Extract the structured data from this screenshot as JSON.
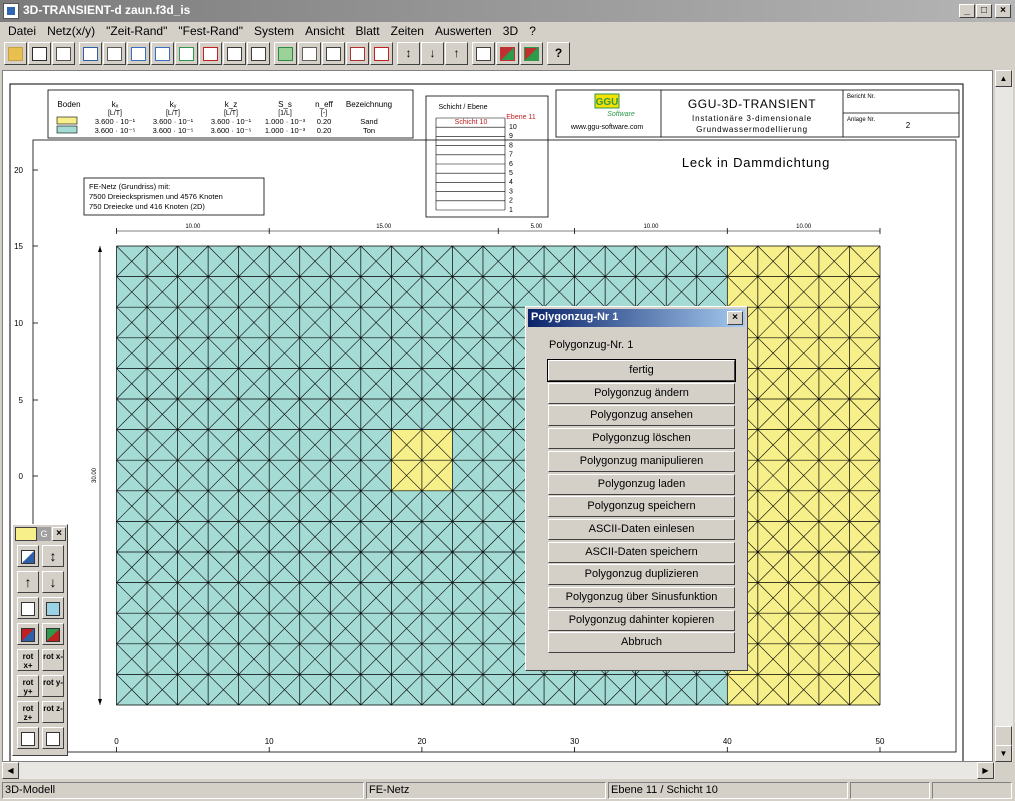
{
  "window": {
    "title": "3D-TRANSIENT-d zaun.f3d_is",
    "minimize": "_",
    "maximize": "□",
    "close": "×"
  },
  "menu": [
    "Datei",
    "Netz(x/y)",
    "\"Zeit-Rand\"",
    "\"Fest-Rand\"",
    "System",
    "Ansicht",
    "Blatt",
    "Zeiten",
    "Auswerten",
    "3D",
    "?"
  ],
  "toolbar": {
    "icons": [
      "open-folder-icon",
      "save-icon",
      "print-icon",
      "filter-icon",
      "page-view-icon",
      "zoom-icon",
      "zoom-in-icon",
      "zoom-node-icon",
      "zoom-element-icon",
      "polygon-select-icon",
      "polygon-icon",
      "grid-icon",
      "copy-icon",
      "clock-icon",
      "frame-icon",
      "house-icon",
      "arrow-updown-icon",
      "arrow-down-icon",
      "arrow-up-icon",
      "mesh-line-icon",
      "color-layer-icon",
      "color-fill-icon",
      "help-icon"
    ],
    "help_label": "?"
  },
  "drawing": {
    "legend": {
      "headers": [
        "Boden",
        "kₓ",
        "kᵧ",
        "k_z",
        "S_s",
        "n_eff",
        "Bezeichnung"
      ],
      "units": [
        "",
        "[L/T]",
        "[L/T]",
        "[L/T]",
        "[1/L]",
        "[-]",
        ""
      ],
      "rows": [
        {
          "color": "#f6ef8a",
          "kx": "3.600 · 10⁻¹",
          "ky": "3.600 · 10⁻¹",
          "kz": "3.600 · 10⁻¹",
          "ss": "1.000 · 10⁻³",
          "neff": "0.20",
          "name": "Sand"
        },
        {
          "color": "#a5dbd5",
          "kx": "3.600 · 10⁻⁵",
          "ky": "3.600 · 10⁻⁵",
          "kz": "3.600 · 10⁻⁵",
          "ss": "1.000 · 10⁻³",
          "neff": "0.20",
          "name": "Ton"
        }
      ]
    },
    "layers": {
      "title": "Schicht / Ebene",
      "current_layer": "Schicht 10",
      "current_plane": "Ebene 11",
      "planes": [
        "10",
        "9",
        "8",
        "7",
        "6",
        "5",
        "4",
        "3",
        "2",
        "1"
      ]
    },
    "titleblock": {
      "logo_text": "GGU",
      "logo_sub": "Software",
      "url": "www.ggu-software.com",
      "app": "GGU-3D-TRANSIENT",
      "line1": "Instationäre 3-dimensionale",
      "line2": "Grundwassermodellierung",
      "report_label": "Bericht Nr.",
      "appendix_label": "Anlage Nr.",
      "appendix_value": "2"
    },
    "heading": "Leck in Dammdichtung",
    "fe_info": [
      "FE-Netz (Grundriss) mit:",
      "7500 Dreiecksprismen und 4576 Knoten",
      "750 Dreiecke und 416 Knoten (2D)"
    ],
    "dimensions_top": [
      "10.00",
      "15.00",
      "5.00",
      "10.00",
      "10.00"
    ],
    "dimension_left": "30.00",
    "y_ticks": [
      "20",
      "15",
      "10",
      "5",
      "0"
    ],
    "x_ticks": [
      "0",
      "10",
      "20",
      "30",
      "40",
      "50"
    ],
    "colors": {
      "ton": "#a5dbd5",
      "sand": "#f6ef8a"
    }
  },
  "dialog": {
    "title": "Polygonzug-Nr 1",
    "label": "Polygonzug-Nr. 1",
    "close": "×",
    "buttons": [
      "fertig",
      "Polygonzug ändern",
      "Polygonzug ansehen",
      "Polygonzug löschen",
      "Polygonzug manipulieren",
      "Polygonzug laden",
      "Polygonzug speichern",
      "ASCII-Daten einlesen",
      "ASCII-Daten speichern",
      "Polygonzug duplizieren",
      "Polygonzug über Sinusfunktion",
      "Polygonzug dahinter kopieren",
      "Abbruch"
    ]
  },
  "palette": {
    "close": "×",
    "buttons": [
      {
        "name": "palette-select-icon",
        "label": ""
      },
      {
        "name": "palette-dim-icon",
        "label": ""
      },
      {
        "name": "palette-updown-icon",
        "label": "↕"
      },
      {
        "name": "palette-up-icon",
        "label": "↑"
      },
      {
        "name": "palette-down-icon",
        "label": "↓"
      },
      {
        "name": "palette-cube-icon",
        "label": ""
      },
      {
        "name": "palette-scissors-icon",
        "label": ""
      },
      {
        "name": "palette-color-icon",
        "label": ""
      },
      {
        "name": "palette-color2-icon",
        "label": ""
      },
      {
        "name": "rot-x-plus-button",
        "label": "rot x+"
      },
      {
        "name": "rot-x-minus-button",
        "label": "rot x-"
      },
      {
        "name": "rot-y-plus-button",
        "label": "rot y+"
      },
      {
        "name": "rot-y-minus-button",
        "label": "rot y-"
      },
      {
        "name": "rot-z-plus-button",
        "label": "rot z+"
      },
      {
        "name": "rot-z-minus-button",
        "label": "rot z-"
      },
      {
        "name": "palette-page-icon",
        "label": ""
      },
      {
        "name": "palette-zoom-page-icon",
        "label": ""
      }
    ]
  },
  "status": [
    "3D-Modell",
    "FE-Netz",
    "Ebene 11 / Schicht 10",
    "",
    ""
  ]
}
